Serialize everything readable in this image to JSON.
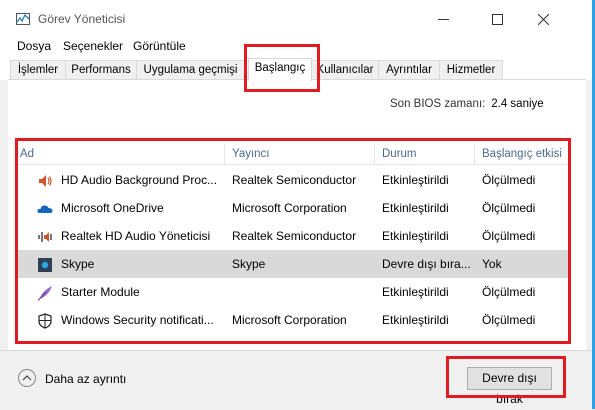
{
  "window": {
    "title": "Görev Yöneticisi"
  },
  "menu": {
    "items": [
      "Dosya",
      "Seçenekler",
      "Görüntüle"
    ]
  },
  "tabs": [
    "İşlemler",
    "Performans",
    "Uygulama geçmişi",
    "Başlangıç",
    "Kullanıcılar",
    "Ayrıntılar",
    "Hizmetler"
  ],
  "active_tab": "Başlangıç",
  "bios": {
    "label": "Son BIOS zamanı:",
    "value": "2.4 saniye"
  },
  "columns": [
    "Ad",
    "Yayıncı",
    "Durum",
    "Başlangıç etkisi"
  ],
  "rows": [
    {
      "name": "HD Audio Background Proc...",
      "publisher": "Realtek Semiconductor",
      "status": "Etkinleştirildi",
      "impact": "Ölçülmedi",
      "icon": "speaker-icon"
    },
    {
      "name": "Microsoft OneDrive",
      "publisher": "Microsoft Corporation",
      "status": "Etkinleştirildi",
      "impact": "Ölçülmedi",
      "icon": "onedrive-icon"
    },
    {
      "name": "Realtek HD Audio Yöneticisi",
      "publisher": "Realtek Semiconductor",
      "status": "Etkinleştirildi",
      "impact": "Ölçülmedi",
      "icon": "audio-manager-icon"
    },
    {
      "name": "Skype",
      "publisher": "Skype",
      "status": "Devre dışı bıra...",
      "impact": "Yok",
      "icon": "skype-icon",
      "selected": true
    },
    {
      "name": "Starter Module",
      "publisher": "",
      "status": "Etkinleştirildi",
      "impact": "Ölçülmedi",
      "icon": "feather-icon"
    },
    {
      "name": "Windows Security notificati...",
      "publisher": "Microsoft Corporation",
      "status": "Etkinleştirildi",
      "impact": "Ölçülmedi",
      "icon": "shield-icon"
    }
  ],
  "footer": {
    "less_details": "Daha az ayrıntı",
    "disable_button": "Devre dışı bırak"
  },
  "colors": {
    "annotation_red": "#e11b22",
    "header_text": "#4d6b8a",
    "selected_row": "#d9d9d9",
    "window_edge": "#2aa0e8"
  }
}
